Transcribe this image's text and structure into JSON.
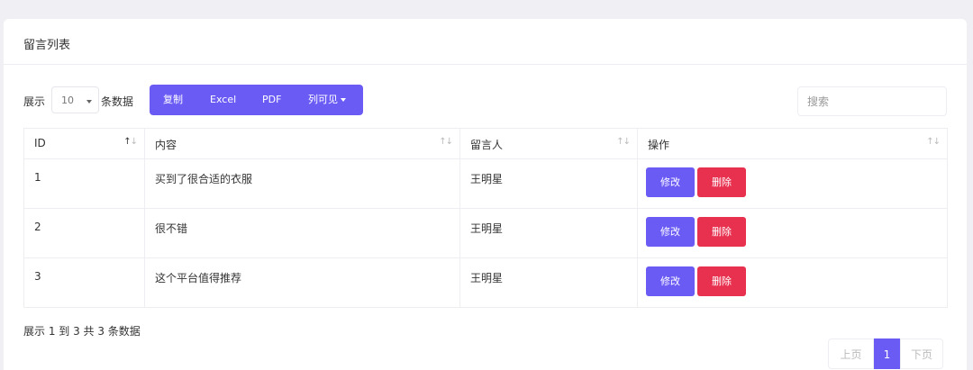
{
  "card": {
    "title": "留言列表"
  },
  "toolbar": {
    "show_label": "展示",
    "page_length": "10",
    "show_suffix": "条数据",
    "buttons": {
      "copy": "复制",
      "excel": "Excel",
      "pdf": "PDF",
      "columns": "列可见"
    },
    "search_placeholder": "搜索"
  },
  "table": {
    "headers": {
      "id": "ID",
      "content": "内容",
      "author": "留言人",
      "actions": "操作"
    },
    "sort_icons": {
      "up": "↑",
      "down": "↓"
    },
    "rows": [
      {
        "id": "1",
        "content": "买到了很合适的衣服",
        "author": "王明星",
        "edit": "修改",
        "delete": "删除"
      },
      {
        "id": "2",
        "content": "很不错",
        "author": "王明星",
        "edit": "修改",
        "delete": "删除"
      },
      {
        "id": "3",
        "content": "这个平台值得推荐",
        "author": "王明星",
        "edit": "修改",
        "delete": "删除"
      }
    ]
  },
  "footer": {
    "info": "展示 1 到 3 共 3 条数据",
    "pagination": {
      "prev": "上页",
      "current": "1",
      "next": "下页"
    }
  },
  "colors": {
    "primary": "#6b5bf5",
    "danger": "#e8304f",
    "background": "#f0eff4"
  }
}
